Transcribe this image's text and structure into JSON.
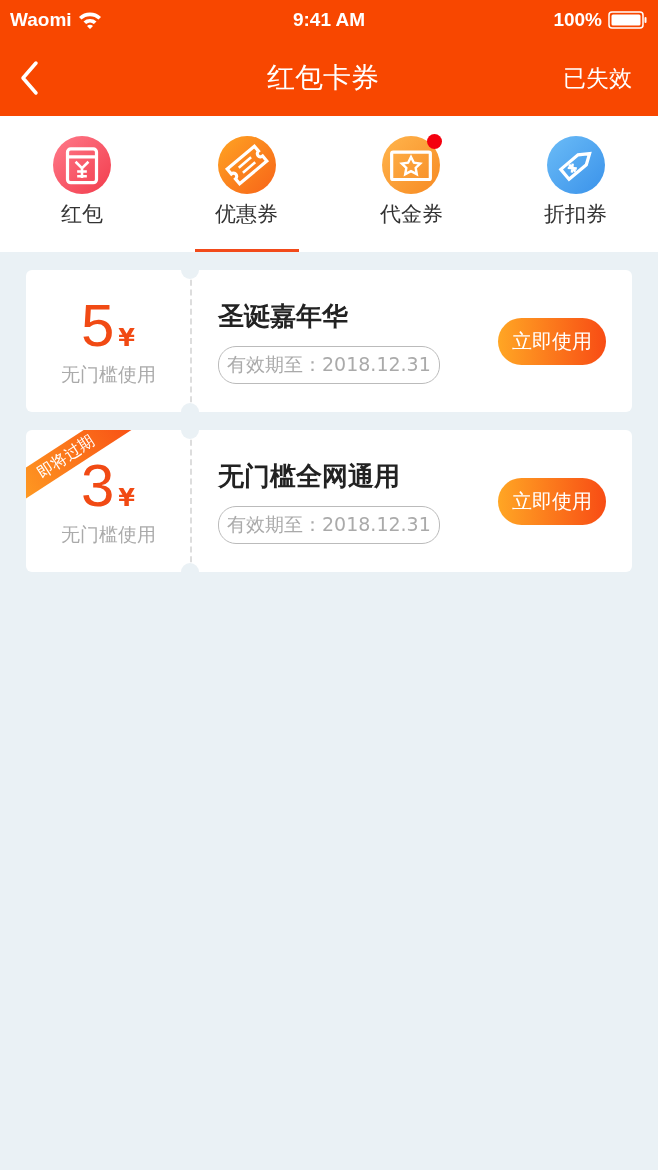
{
  "status_bar": {
    "carrier": "Waomi",
    "time": "9:41 AM",
    "battery": "100%"
  },
  "nav_bar": {
    "title": "红包卡券",
    "action": "已失效"
  },
  "tabs": [
    {
      "label": "红包",
      "kind": "envelope",
      "selected": false,
      "badge": false
    },
    {
      "label": "优惠券",
      "kind": "ticket",
      "selected": true,
      "badge": false
    },
    {
      "label": "代金券",
      "kind": "voucher",
      "selected": false,
      "badge": true
    },
    {
      "label": "折扣券",
      "kind": "tag",
      "selected": false,
      "badge": false
    }
  ],
  "coupons": [
    {
      "amount": "5",
      "currency": "¥",
      "condition": "无门槛使用",
      "title": "圣诞嘉年华",
      "validity": "有效期至：2018.12.31",
      "button": "立即使用"
    },
    {
      "amount": "3",
      "currency": "¥",
      "condition": "无门槛使用",
      "title": "无门槛全网通用",
      "validity": "有效期至：2018.12.31",
      "button": "立即使用",
      "ribbon": "即将过期"
    }
  ]
}
